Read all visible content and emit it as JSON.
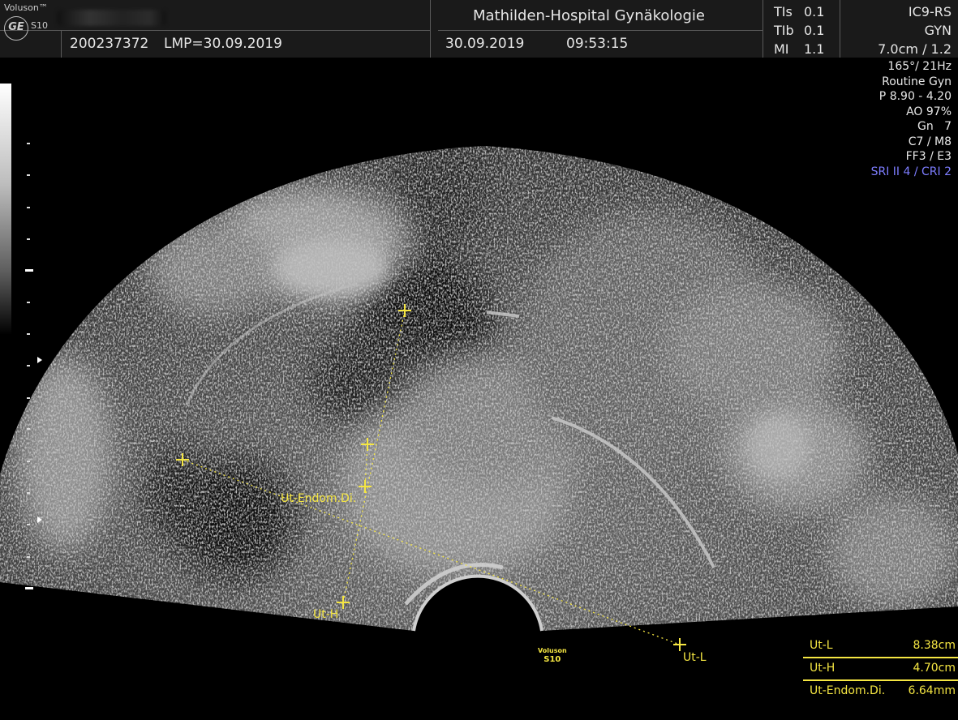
{
  "header": {
    "brand": "Voluson™",
    "logo": "GE",
    "model": "S10",
    "patient_id": "200237372",
    "lmp": "LMP=30.09.2019",
    "hospital": "Mathilden-Hospital Gynäkologie",
    "date": "30.09.2019",
    "time": "09:53:15",
    "tis": "TIs",
    "tis_val": "0.1",
    "tib": "TIb",
    "tib_val": "0.1",
    "mi": "MI",
    "mi_val": "1.1",
    "probe": "IC9-RS",
    "preset": "GYN",
    "depth": "7.0cm / 1.2"
  },
  "params": [
    "165°/ 21Hz",
    "Routine Gyn",
    "P 8.90 - 4.20",
    "AO 97%",
    "Gn   7",
    "C7 / M8",
    "FF3 / E3"
  ],
  "sri_param": "SRI II 4 / CRI 2",
  "labels": {
    "endom": "Ut-Endom.Di.",
    "uth": "Ut-H",
    "utl": "Ut-L"
  },
  "probe_mark": {
    "brand": "Voluson",
    "model": "S10"
  },
  "measurements": [
    {
      "name": "Ut-L",
      "value": "8.38cm"
    },
    {
      "name": "Ut-H",
      "value": "4.70cm"
    },
    {
      "name": "Ut-Endom.Di.",
      "value": "6.64mm"
    }
  ],
  "colors": {
    "annotation": "#f5e642",
    "sri_text": "#7d7dff"
  }
}
